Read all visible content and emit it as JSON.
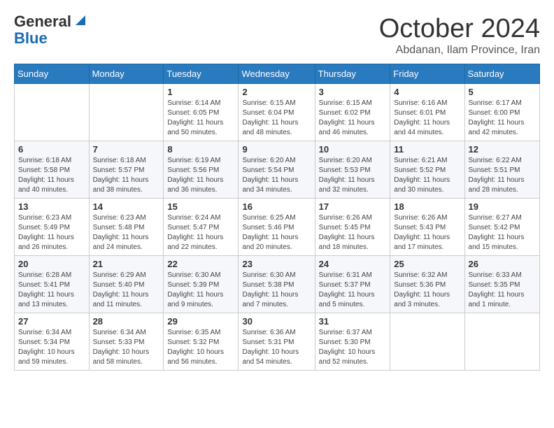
{
  "header": {
    "logo_general": "General",
    "logo_blue": "Blue",
    "month": "October 2024",
    "location": "Abdanan, Ilam Province, Iran"
  },
  "days_of_week": [
    "Sunday",
    "Monday",
    "Tuesday",
    "Wednesday",
    "Thursday",
    "Friday",
    "Saturday"
  ],
  "weeks": [
    [
      {
        "day": "",
        "empty": true
      },
      {
        "day": "",
        "empty": true
      },
      {
        "day": "1",
        "sunrise": "6:14 AM",
        "sunset": "6:05 PM",
        "daylight": "11 hours and 50 minutes."
      },
      {
        "day": "2",
        "sunrise": "6:15 AM",
        "sunset": "6:04 PM",
        "daylight": "11 hours and 48 minutes."
      },
      {
        "day": "3",
        "sunrise": "6:15 AM",
        "sunset": "6:02 PM",
        "daylight": "11 hours and 46 minutes."
      },
      {
        "day": "4",
        "sunrise": "6:16 AM",
        "sunset": "6:01 PM",
        "daylight": "11 hours and 44 minutes."
      },
      {
        "day": "5",
        "sunrise": "6:17 AM",
        "sunset": "6:00 PM",
        "daylight": "11 hours and 42 minutes."
      }
    ],
    [
      {
        "day": "6",
        "sunrise": "6:18 AM",
        "sunset": "5:58 PM",
        "daylight": "11 hours and 40 minutes."
      },
      {
        "day": "7",
        "sunrise": "6:18 AM",
        "sunset": "5:57 PM",
        "daylight": "11 hours and 38 minutes."
      },
      {
        "day": "8",
        "sunrise": "6:19 AM",
        "sunset": "5:56 PM",
        "daylight": "11 hours and 36 minutes."
      },
      {
        "day": "9",
        "sunrise": "6:20 AM",
        "sunset": "5:54 PM",
        "daylight": "11 hours and 34 minutes."
      },
      {
        "day": "10",
        "sunrise": "6:20 AM",
        "sunset": "5:53 PM",
        "daylight": "11 hours and 32 minutes."
      },
      {
        "day": "11",
        "sunrise": "6:21 AM",
        "sunset": "5:52 PM",
        "daylight": "11 hours and 30 minutes."
      },
      {
        "day": "12",
        "sunrise": "6:22 AM",
        "sunset": "5:51 PM",
        "daylight": "11 hours and 28 minutes."
      }
    ],
    [
      {
        "day": "13",
        "sunrise": "6:23 AM",
        "sunset": "5:49 PM",
        "daylight": "11 hours and 26 minutes."
      },
      {
        "day": "14",
        "sunrise": "6:23 AM",
        "sunset": "5:48 PM",
        "daylight": "11 hours and 24 minutes."
      },
      {
        "day": "15",
        "sunrise": "6:24 AM",
        "sunset": "5:47 PM",
        "daylight": "11 hours and 22 minutes."
      },
      {
        "day": "16",
        "sunrise": "6:25 AM",
        "sunset": "5:46 PM",
        "daylight": "11 hours and 20 minutes."
      },
      {
        "day": "17",
        "sunrise": "6:26 AM",
        "sunset": "5:45 PM",
        "daylight": "11 hours and 18 minutes."
      },
      {
        "day": "18",
        "sunrise": "6:26 AM",
        "sunset": "5:43 PM",
        "daylight": "11 hours and 17 minutes."
      },
      {
        "day": "19",
        "sunrise": "6:27 AM",
        "sunset": "5:42 PM",
        "daylight": "11 hours and 15 minutes."
      }
    ],
    [
      {
        "day": "20",
        "sunrise": "6:28 AM",
        "sunset": "5:41 PM",
        "daylight": "11 hours and 13 minutes."
      },
      {
        "day": "21",
        "sunrise": "6:29 AM",
        "sunset": "5:40 PM",
        "daylight": "11 hours and 11 minutes."
      },
      {
        "day": "22",
        "sunrise": "6:30 AM",
        "sunset": "5:39 PM",
        "daylight": "11 hours and 9 minutes."
      },
      {
        "day": "23",
        "sunrise": "6:30 AM",
        "sunset": "5:38 PM",
        "daylight": "11 hours and 7 minutes."
      },
      {
        "day": "24",
        "sunrise": "6:31 AM",
        "sunset": "5:37 PM",
        "daylight": "11 hours and 5 minutes."
      },
      {
        "day": "25",
        "sunrise": "6:32 AM",
        "sunset": "5:36 PM",
        "daylight": "11 hours and 3 minutes."
      },
      {
        "day": "26",
        "sunrise": "6:33 AM",
        "sunset": "5:35 PM",
        "daylight": "11 hours and 1 minute."
      }
    ],
    [
      {
        "day": "27",
        "sunrise": "6:34 AM",
        "sunset": "5:34 PM",
        "daylight": "10 hours and 59 minutes."
      },
      {
        "day": "28",
        "sunrise": "6:34 AM",
        "sunset": "5:33 PM",
        "daylight": "10 hours and 58 minutes."
      },
      {
        "day": "29",
        "sunrise": "6:35 AM",
        "sunset": "5:32 PM",
        "daylight": "10 hours and 56 minutes."
      },
      {
        "day": "30",
        "sunrise": "6:36 AM",
        "sunset": "5:31 PM",
        "daylight": "10 hours and 54 minutes."
      },
      {
        "day": "31",
        "sunrise": "6:37 AM",
        "sunset": "5:30 PM",
        "daylight": "10 hours and 52 minutes."
      },
      {
        "day": "",
        "empty": true
      },
      {
        "day": "",
        "empty": true
      }
    ]
  ]
}
